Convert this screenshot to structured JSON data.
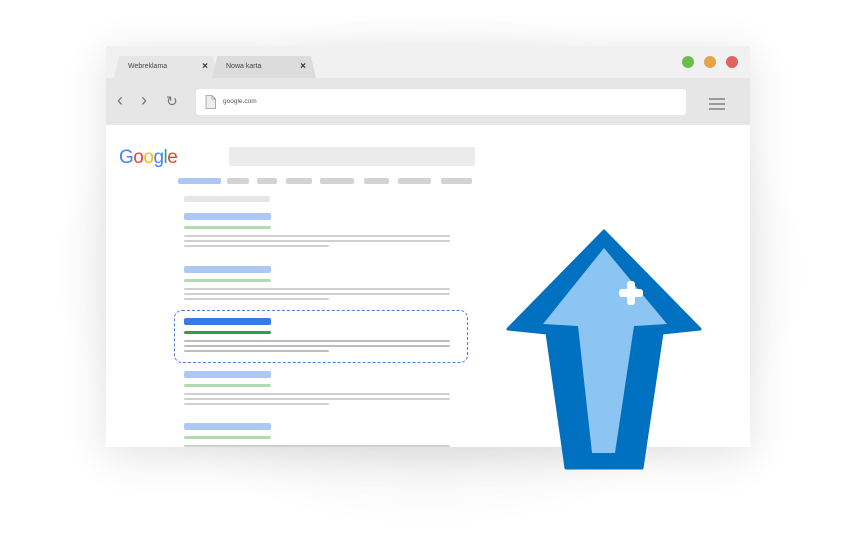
{
  "tabs": [
    {
      "label": "Webreklama",
      "close": "×",
      "active": true
    },
    {
      "label": "Nowa karta",
      "close": "×",
      "active": false
    }
  ],
  "window_controls": {
    "colors": [
      "#6abe4b",
      "#e5a349",
      "#e06360"
    ]
  },
  "address_bar": {
    "url": "google.com"
  },
  "logo": {
    "letters": [
      "G",
      "o",
      "o",
      "g",
      "l",
      "e"
    ],
    "colors": [
      "#4285f4",
      "#ea4335",
      "#fbbc05",
      "#4285f4",
      "#34a853",
      "#ea4335"
    ]
  },
  "highlighted_result_index": 2,
  "colors": {
    "accent_blue": "#0070c0",
    "arrow_fill": "#8cc4f2",
    "result_title": "#aec8f4",
    "result_url": "#b2dbb1",
    "result_title_active": "#3b78e7",
    "result_url_active": "#2f9e44"
  },
  "icons": [
    "back-arrow-icon",
    "forward-arrow-icon",
    "reload-icon",
    "file-icon",
    "hamburger-menu-icon",
    "up-arrow-icon",
    "plus-icon"
  ]
}
